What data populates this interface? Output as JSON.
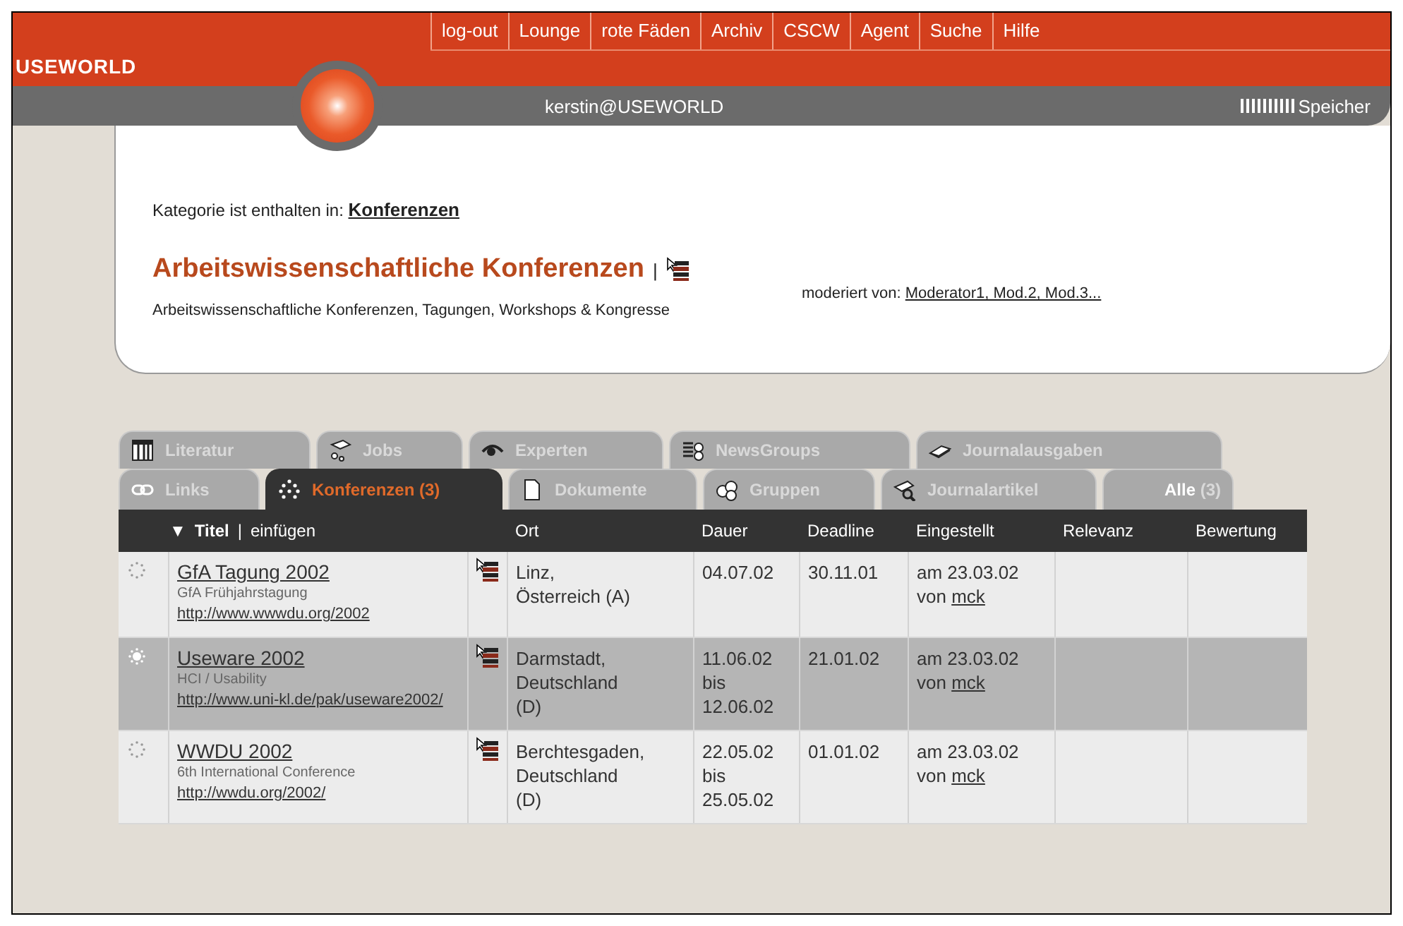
{
  "header": {
    "logo": "USEWORLD",
    "nav": [
      {
        "label": "log-out"
      },
      {
        "label": "Lounge"
      },
      {
        "label": "rote Fäden"
      },
      {
        "label": "Archiv"
      },
      {
        "label": "CSCW"
      },
      {
        "label": "Agent"
      },
      {
        "label": "Suche"
      },
      {
        "label": "Hilfe"
      }
    ],
    "user": "kerstin@USEWORLD",
    "memory_label": "Speicher"
  },
  "category": {
    "prefix": "Kategorie ist enthalten in:",
    "parent": "Konferenzen",
    "title": "Arbeitswissenschaftliche Konferenzen",
    "separator": "|",
    "description": "Arbeitswissenschaftliche Konferenzen, Tagungen, Workshops & Kongresse",
    "moderated_prefix": "moderiert von:",
    "moderators": "Moderator1, Mod.2, Mod.3..."
  },
  "tab_rows": [
    {
      "tabs": [
        {
          "label": "Literatur",
          "selected": false
        },
        {
          "label": "Jobs",
          "selected": false
        },
        {
          "label": "Experten",
          "selected": false
        },
        {
          "label": "NewsGroups",
          "selected": false
        },
        {
          "label": "Journalausgaben",
          "selected": false
        }
      ]
    },
    {
      "tabs": [
        {
          "label": "Links",
          "selected": false
        },
        {
          "label": "Konferenzen (3)",
          "selected": true
        },
        {
          "label": "Dokumente",
          "selected": false
        },
        {
          "label": "Gruppen",
          "selected": false
        },
        {
          "label": "Journalartikel",
          "selected": false
        },
        {
          "label": "**Alle** (3)",
          "selected": false
        }
      ]
    }
  ],
  "table": {
    "title_column": {
      "arrow": "▼",
      "label": "Titel",
      "separator": "|",
      "action": "einfügen"
    },
    "columns": [
      "Ort",
      "Dauer",
      "Deadline",
      "Eingestellt",
      "Relevanz",
      "Bewertung"
    ],
    "rows": [
      {
        "selected": false,
        "title": "GfA Tagung 2002",
        "subtitle": "GfA Frühjahrstagung",
        "url": "http://www.wwwdu.org/2002",
        "place": "Linz,\nÖsterreich (A)",
        "duration": "04.07.02",
        "deadline": "30.11.01",
        "posted": "am 23.03.02",
        "posted_by_prefix": "von",
        "posted_by": "mck"
      },
      {
        "selected": true,
        "title": "Useware 2002",
        "subtitle": "HCI / Usability",
        "url": "http://www.uni-kl.de/pak/useware2002/",
        "place": "Darmstadt,\nDeutschland\n(D)",
        "duration": "11.06.02\nbis\n12.06.02",
        "deadline": "21.01.02",
        "posted": "am 23.03.02",
        "posted_by_prefix": "von",
        "posted_by": "mck"
      },
      {
        "selected": false,
        "title": "WWDU 2002",
        "subtitle": "6th International Conference",
        "url": "http://wwdu.org/2002/",
        "place": "Berchtesgaden,\nDeutschland\n(D)",
        "duration": "22.05.02\nbis\n25.05.02",
        "deadline": "01.01.02",
        "posted": "am 23.03.02",
        "posted_by_prefix": "von",
        "posted_by": "mck"
      }
    ]
  }
}
